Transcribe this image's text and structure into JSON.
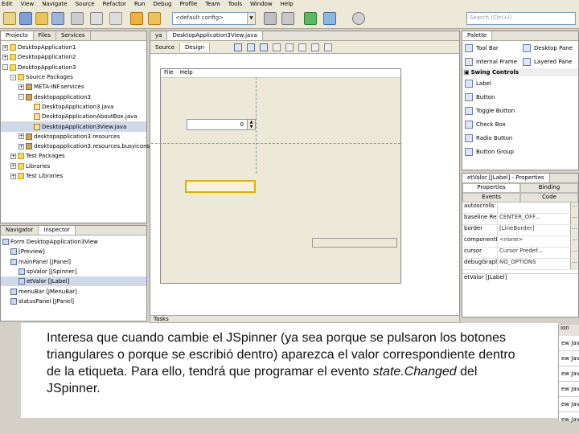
{
  "menu": [
    "Edit",
    "View",
    "Navigate",
    "Source",
    "Refactor",
    "Run",
    "Debug",
    "Profile",
    "Team",
    "Tools",
    "Window",
    "Help"
  ],
  "toolbar": {
    "config_combo": "<default config>",
    "search_placeholder": "Search (Ctrl+I)"
  },
  "projects": {
    "tabs": [
      "Projects",
      "Files",
      "Services"
    ],
    "tree": [
      {
        "label": "DesktopApplication1",
        "depth": 0,
        "kind": "project",
        "exp": "+"
      },
      {
        "label": "DesktopApplication2",
        "depth": 0,
        "kind": "project",
        "exp": "+"
      },
      {
        "label": "DesktopApplication3",
        "depth": 0,
        "kind": "project",
        "exp": "-"
      },
      {
        "label": "Source Packages",
        "depth": 1,
        "kind": "folder",
        "exp": "-"
      },
      {
        "label": "META-INF.services",
        "depth": 2,
        "kind": "pkg",
        "exp": "+"
      },
      {
        "label": "desktopapplication3",
        "depth": 2,
        "kind": "pkg",
        "exp": "-"
      },
      {
        "label": "DesktopApplication3.java",
        "depth": 3,
        "kind": "java",
        "exp": ""
      },
      {
        "label": "DesktopApplicationAboutBox.java",
        "depth": 3,
        "kind": "java",
        "exp": ""
      },
      {
        "label": "DesktopApplication3View.java",
        "depth": 3,
        "kind": "java",
        "exp": "",
        "selected": true
      },
      {
        "label": "desktopapplication3.resources",
        "depth": 2,
        "kind": "pkg",
        "exp": "+"
      },
      {
        "label": "desktopapplication3.resources.busyicons",
        "depth": 2,
        "kind": "pkg",
        "exp": "+"
      },
      {
        "label": "Test Packages",
        "depth": 1,
        "kind": "folder",
        "exp": "+"
      },
      {
        "label": "Libraries",
        "depth": 1,
        "kind": "folder",
        "exp": "+"
      },
      {
        "label": "Test Libraries",
        "depth": 1,
        "kind": "folder",
        "exp": "+"
      }
    ]
  },
  "inspector": {
    "tabs": [
      "Navigator",
      "Inspector"
    ],
    "tree": [
      {
        "label": "Form DesktopApplication3View",
        "depth": 0
      },
      {
        "label": "[Preview]",
        "depth": 1
      },
      {
        "label": "mainPanel [JPanel]",
        "depth": 1
      },
      {
        "label": "spValor [JSpinner]",
        "depth": 2
      },
      {
        "label": "etValor [JLabel]",
        "depth": 2,
        "selected": true
      },
      {
        "label": "menuBar [JMenuBar]",
        "depth": 1
      },
      {
        "label": "statusPanel [JPanel]",
        "depth": 1
      }
    ]
  },
  "editor": {
    "tabs": [
      "ya",
      "DesktopApplication3View.java"
    ],
    "mode_tabs": [
      "Source",
      "Design"
    ],
    "form_menu": [
      "File",
      "Help"
    ],
    "spinner_value": "0"
  },
  "palette": {
    "title": "Palette",
    "items_top": [
      "Tool Bar",
      "Desktop Pane",
      "Internal Frame",
      "Layered Pane"
    ],
    "section": "Swing Controls",
    "controls": [
      "Label",
      "Button",
      "Toggle Button",
      "Check Box",
      "Radio Button",
      "Button Group"
    ]
  },
  "properties": {
    "title": "etValor [JLabel] - Properties",
    "tabs": [
      "Properties",
      "Binding",
      "Events",
      "Code"
    ],
    "rows": [
      {
        "k": "autoscrolls",
        "v": ""
      },
      {
        "k": "baseline ResizeBehavior",
        "v": "CENTER_OFF..."
      },
      {
        "k": "border",
        "v": "[LineBorder]"
      },
      {
        "k": "componentPopupMenu",
        "v": "<none>"
      },
      {
        "k": "cursor",
        "v": "Cursor Predef..."
      },
      {
        "k": "debugGraphicsOptions",
        "v": "NO_OPTIONS"
      }
    ],
    "footer": "etValor [JLabel]"
  },
  "tasks": {
    "title": "Tasks",
    "right_header": "ion",
    "right_rows": [
      "ew Java",
      "ew Java",
      "ew Java",
      "ew Java",
      "ew Java",
      "ew Java"
    ]
  },
  "caption": {
    "before": "Interesa que cuando cambie el JSpinner (ya sea porque se pulsaron los botones triangulares o porque se escribió dentro) aparezca el valor correspondiente dentro de la etiqueta. Para ello, tendrá que programar el evento ",
    "italic": "state.Changed",
    "after": " del JSpinner."
  }
}
